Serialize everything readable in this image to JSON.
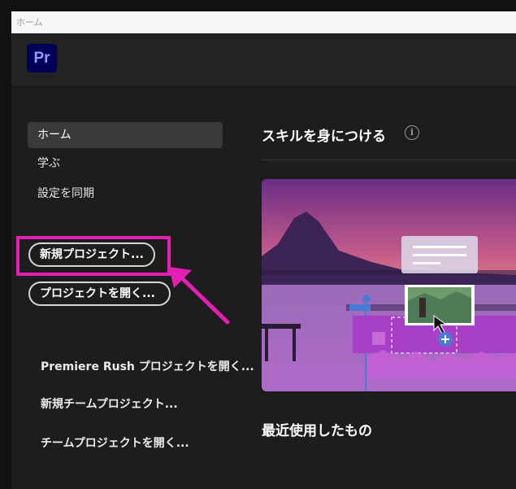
{
  "window": {
    "title": "ホーム"
  },
  "app": {
    "logo_text": "Pr",
    "brand_color": "#00005b",
    "logo_text_color": "#9999ff"
  },
  "sidebar": {
    "items": [
      {
        "label": "ホーム",
        "active": true
      },
      {
        "label": "学ぶ",
        "active": false
      },
      {
        "label": "設定を同期",
        "active": false
      }
    ],
    "new_project_label": "新規プロジェクト...",
    "open_project_label": "プロジェクトを開く...",
    "links": [
      {
        "label": "Premiere Rush プロジェクトを開く..."
      },
      {
        "label": "新規チームプロジェクト..."
      },
      {
        "label": "チームプロジェクトを開く..."
      }
    ]
  },
  "main": {
    "skills_title": "スキルを身につける",
    "recent_title": "最近使用したもの"
  },
  "annotation": {
    "highlight_color": "#e51fb5"
  }
}
